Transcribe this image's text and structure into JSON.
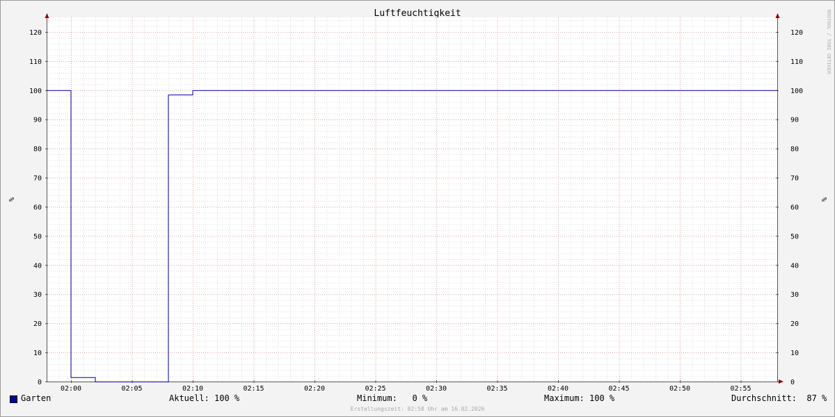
{
  "chart_data": {
    "type": "line",
    "title": "Luftfeuchtigkeit",
    "ylabel": "%",
    "ylim": [
      0,
      125
    ],
    "yticks": [
      0,
      10,
      20,
      30,
      40,
      50,
      60,
      70,
      80,
      90,
      100,
      110,
      120
    ],
    "xlim": [
      "01:58",
      "02:58"
    ],
    "xticks": [
      "02:00",
      "02:05",
      "02:10",
      "02:15",
      "02:20",
      "02:25",
      "02:30",
      "02:35",
      "02:40",
      "02:45",
      "02:50",
      "02:55"
    ],
    "grid": true,
    "line_color": "#0000a0",
    "series": [
      {
        "name": "Garten",
        "points": [
          [
            "01:58",
            100
          ],
          [
            "02:00",
            100
          ],
          [
            "02:00",
            1.5
          ],
          [
            "02:02",
            1.5
          ],
          [
            "02:02",
            0
          ],
          [
            "02:08",
            0
          ],
          [
            "02:08",
            98.5
          ],
          [
            "02:10",
            98.5
          ],
          [
            "02:10",
            100
          ],
          [
            "02:58",
            100
          ]
        ]
      }
    ],
    "watermark": "RRDTOOL / TOBI OETIKER"
  },
  "legend": {
    "series_name": "Garten",
    "current": "Aktuell: 100 %",
    "minimum": "Minimum:   0 %",
    "maximum": "Maximum: 100 %",
    "average": "Durchschnitt:  87 %"
  },
  "footer": {
    "credit": "Erstellungszeit: 02:58 Uhr am 16.02.2026"
  }
}
